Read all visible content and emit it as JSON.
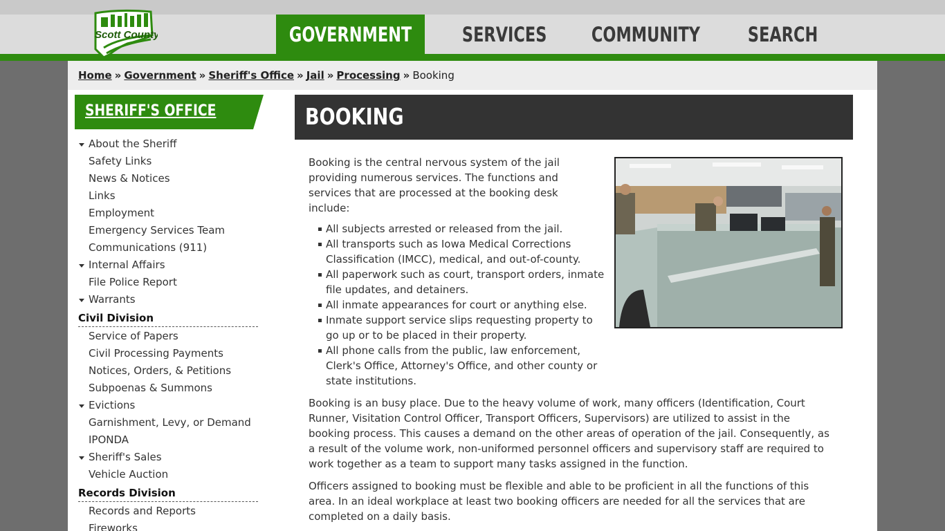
{
  "site": {
    "logo_text": "Scott County"
  },
  "nav": [
    {
      "label": "GOVERNMENT",
      "active": true
    },
    {
      "label": "SERVICES",
      "active": false
    },
    {
      "label": "COMMUNITY",
      "active": false
    },
    {
      "label": "SEARCH",
      "active": false
    }
  ],
  "breadcrumb": {
    "items": [
      "Home",
      "Government",
      "Sheriff's Office",
      "Jail",
      "Processing"
    ],
    "separator": "»",
    "current": "Booking"
  },
  "sidebar": {
    "heading": "SHERIFF'S OFFICE",
    "items": [
      {
        "label": "About the Sheriff",
        "type": "item",
        "expandable": true
      },
      {
        "label": "Safety Links",
        "type": "item",
        "expandable": false
      },
      {
        "label": "News & Notices",
        "type": "item",
        "expandable": false
      },
      {
        "label": "Links",
        "type": "item",
        "expandable": false
      },
      {
        "label": "Employment",
        "type": "item",
        "expandable": false
      },
      {
        "label": "Emergency Services Team",
        "type": "item",
        "expandable": false
      },
      {
        "label": "Communications (911)",
        "type": "item",
        "expandable": false
      },
      {
        "label": "Internal Affairs",
        "type": "item",
        "expandable": true
      },
      {
        "label": "File Police Report",
        "type": "item",
        "expandable": false
      },
      {
        "label": "Warrants",
        "type": "item",
        "expandable": true
      },
      {
        "label": "Civil Division",
        "type": "group",
        "expandable": false
      },
      {
        "label": "Service of Papers",
        "type": "item",
        "expandable": false
      },
      {
        "label": "Civil Processing Payments",
        "type": "item",
        "expandable": false
      },
      {
        "label": "Notices, Orders, & Petitions",
        "type": "item",
        "expandable": false
      },
      {
        "label": "Subpoenas & Summons",
        "type": "item",
        "expandable": false
      },
      {
        "label": "Evictions",
        "type": "item",
        "expandable": true
      },
      {
        "label": "Garnishment, Levy, or Demand",
        "type": "item",
        "expandable": false
      },
      {
        "label": "IPONDA",
        "type": "item",
        "expandable": false
      },
      {
        "label": "Sheriff's Sales",
        "type": "item",
        "expandable": true
      },
      {
        "label": "Vehicle Auction",
        "type": "item",
        "expandable": false
      },
      {
        "label": "Records Division",
        "type": "group",
        "expandable": false
      },
      {
        "label": "Records and Reports",
        "type": "item",
        "expandable": false
      },
      {
        "label": "Fireworks",
        "type": "item",
        "expandable": false
      }
    ]
  },
  "main": {
    "title": "BOOKING",
    "intro": "Booking is the central nervous system of the jail providing numerous services. The functions and services that are processed at the booking desk include:",
    "bullets": [
      "All subjects arrested or released from the jail.",
      "All transports such as Iowa Medical Corrections Classification (IMCC), medical, and out-of-county.",
      "All paperwork such as court, transport orders, inmate file updates, and detainers.",
      "All inmate appearances for court or anything else.",
      "Inmate support service slips requesting property to go up or to be placed in their property.",
      "All phone calls from the public, law enforcement, Clerk's Office, Attorney's Office, and other county or state institutions."
    ],
    "paragraph2": "Booking is an busy place. Due to the heavy volume of work, many officers (Identification, Court Runner, Visitation Control Officer, Transport Officers, Supervisors) are utilized to assist in the booking process. This causes a demand on the other areas of operation of the jail. Consequently, as a result of the volume work, non-uniformed personnel officers and supervisory staff are required to work together as a team to support many tasks assigned in the function.",
    "paragraph3": "Officers assigned to booking must be flexible and able to be proficient in all the functions of this area. In an ideal workplace at least two booking officers are needed for all the services that are completed on a daily basis."
  },
  "colors": {
    "brand_green": "#2e8b0f",
    "header_dark": "#333333",
    "page_bg": "#6e6e6e"
  }
}
